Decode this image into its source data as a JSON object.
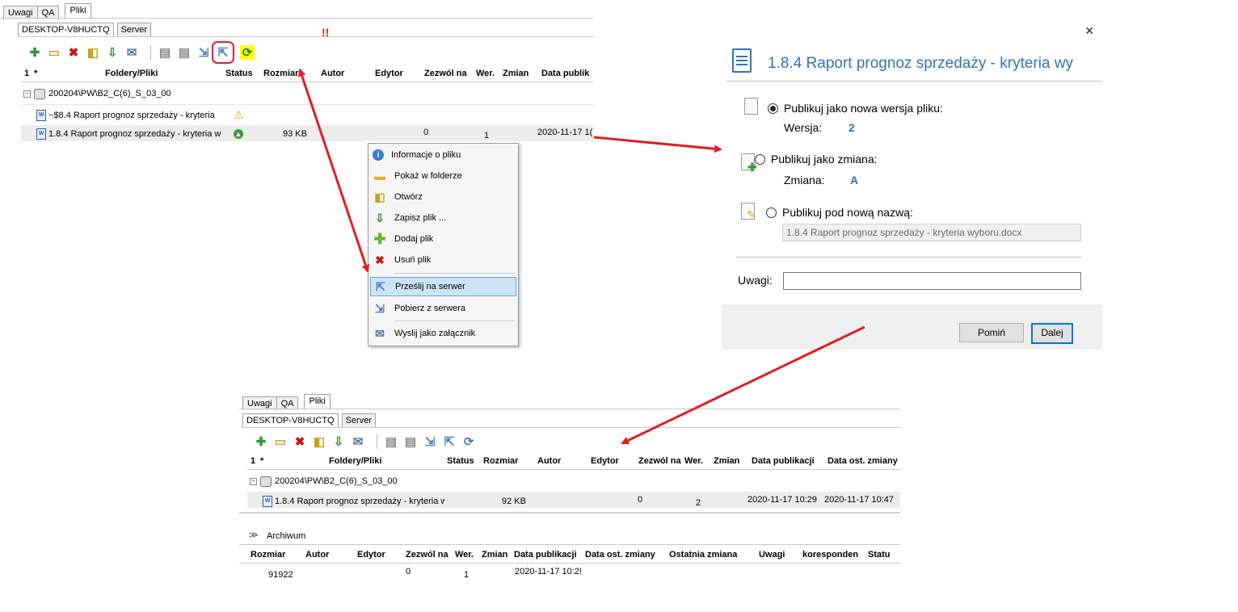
{
  "top": {
    "tabs": [
      "Uwagi",
      "QA",
      "Pliki"
    ],
    "subtabs": [
      "DESKTOP-V8HUCTQ",
      "Server"
    ],
    "marker": "!!",
    "columns": [
      "1",
      "*",
      "Foldery/Pliki",
      "Status",
      "Rozmiar",
      "Autor",
      "Edytor",
      "Zezwól na",
      "Wer.",
      "Zmian",
      "Data publik"
    ],
    "folder": "200204\\PW\\B2_C(6)_S_03_00",
    "rows": [
      {
        "name": "~$8.4 Raport prognoz sprzedaży - kryteria",
        "status": "warning-icon"
      },
      {
        "name": "1.8.4 Raport prognoz sprzedaży - kryteria w",
        "size": "93 KB",
        "zezwol": "0",
        "wer": "1",
        "data": "2020-11-17 1("
      }
    ]
  },
  "menu": {
    "items": [
      {
        "label": "Informacje o pliku",
        "icon": "info-icon"
      },
      {
        "label": "Pokaż w folderze",
        "icon": "folder-icon"
      },
      {
        "label": "Otwórz",
        "icon": "open-icon"
      },
      {
        "label": "Zapisz plik ...",
        "icon": "save-icon"
      },
      {
        "label": "Dodaj plik",
        "icon": "add-icon"
      },
      {
        "label": "Usuń plik",
        "icon": "delete-icon"
      },
      {
        "label": "Prześlij na serwer",
        "icon": "upload-icon"
      },
      {
        "label": "Pobierz z serwera",
        "icon": "download-icon"
      },
      {
        "label": "Wyslij jako załącznik",
        "icon": "mail-icon"
      }
    ]
  },
  "dialog": {
    "close": "×",
    "title": "1.8.4 Raport prognoz sprzedaży - kryteria wy",
    "opt1": "Publikuj jako nowa wersja pliku:",
    "wersja_label": "Wersja:",
    "wersja_value": "2",
    "opt2": "Publikuj jako zmiana:",
    "zmiana_label": "Zmiana:",
    "zmiana_value": "A",
    "opt3": "Publikuj pod nową nazwą:",
    "new_name": "1.8.4 Raport prognoz sprzedaży - kryteria wyboru.docx",
    "uwagi_label": "Uwagi:",
    "uwagi_value": "",
    "skip": "Pomiń",
    "next": "Dalej"
  },
  "bottom": {
    "tabs": [
      "Uwagi",
      "QA",
      "Pliki"
    ],
    "subtabs": [
      "DESKTOP-V8HUCTQ",
      "Server"
    ],
    "columns": [
      "1",
      "*",
      "Foldery/Pliki",
      "Status",
      "Rozmiar",
      "Autor",
      "Edytor",
      "Zezwól na",
      "Wer.",
      "Zmian",
      "Data publikacji",
      "Data ost. zmiany"
    ],
    "folder": "200204\\PW\\B2_C(6)_S_03_00",
    "row": {
      "name": "1.8.4 Raport prognoz sprzedaży - kryteria w",
      "size": "92 KB",
      "zezwol": "0",
      "wer": "2",
      "data_pub": "2020-11-17 10:29",
      "data_zm": "2020-11-17 10:47"
    },
    "archive_label": "Archiwum",
    "arch_columns": [
      "Rozmiar",
      "Autor",
      "Edytor",
      "Zezwól na",
      "Wer.",
      "Zmian",
      "Data publikacji",
      "Data ost. zmiany",
      "Ostatnia zmiana",
      "Uwagi",
      "koresponden",
      "Statu"
    ],
    "arch_row": {
      "size": "91922",
      "zezwol": "0",
      "wer": "1",
      "data": "2020-11-17 10:2!"
    }
  },
  "colors": {
    "arrow": "#e02020",
    "highlight": "#ffff00",
    "accent": "#2e75b6"
  }
}
